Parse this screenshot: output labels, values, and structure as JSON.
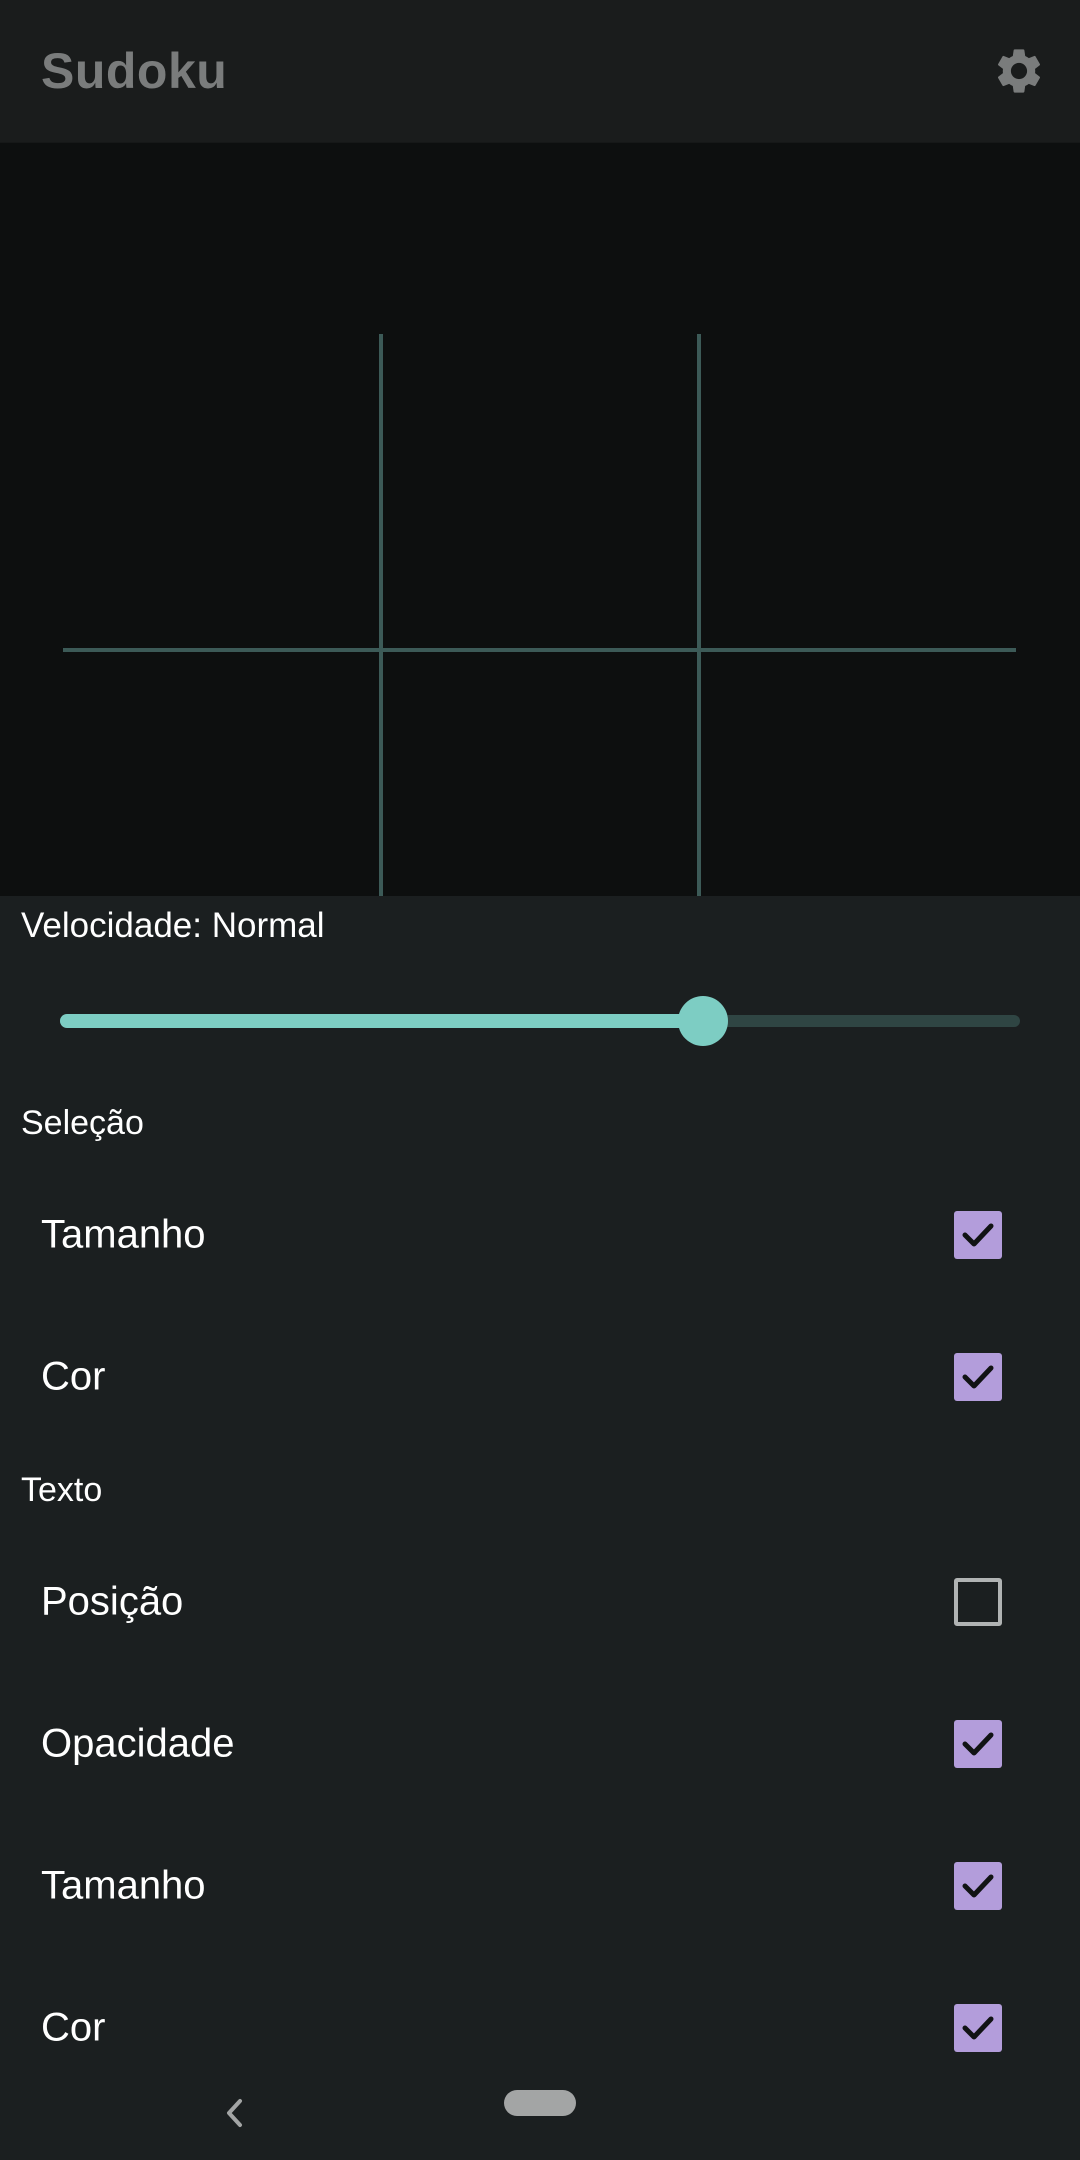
{
  "app_bar": {
    "title": "Sudoku",
    "settings_icon": "gear-icon"
  },
  "speed": {
    "label": "Velocidade: Normal",
    "slider_fraction": 0.67
  },
  "sections": [
    {
      "header": "Seleção",
      "items": [
        {
          "label": "Tamanho",
          "checked": true
        },
        {
          "label": "Cor",
          "checked": true
        }
      ]
    },
    {
      "header": "Texto",
      "items": [
        {
          "label": "Posição",
          "checked": false
        },
        {
          "label": "Opacidade",
          "checked": true
        },
        {
          "label": "Tamanho",
          "checked": true
        },
        {
          "label": "Cor",
          "checked": true
        }
      ]
    }
  ],
  "colors": {
    "accent": "#7dcdc3",
    "checkbox": "#b39ddb",
    "grid_line": "#3c5a57",
    "background": "#1b1f20"
  },
  "nav": {
    "back_icon": "chevron-left-icon",
    "home_icon": "home-pill-icon"
  }
}
